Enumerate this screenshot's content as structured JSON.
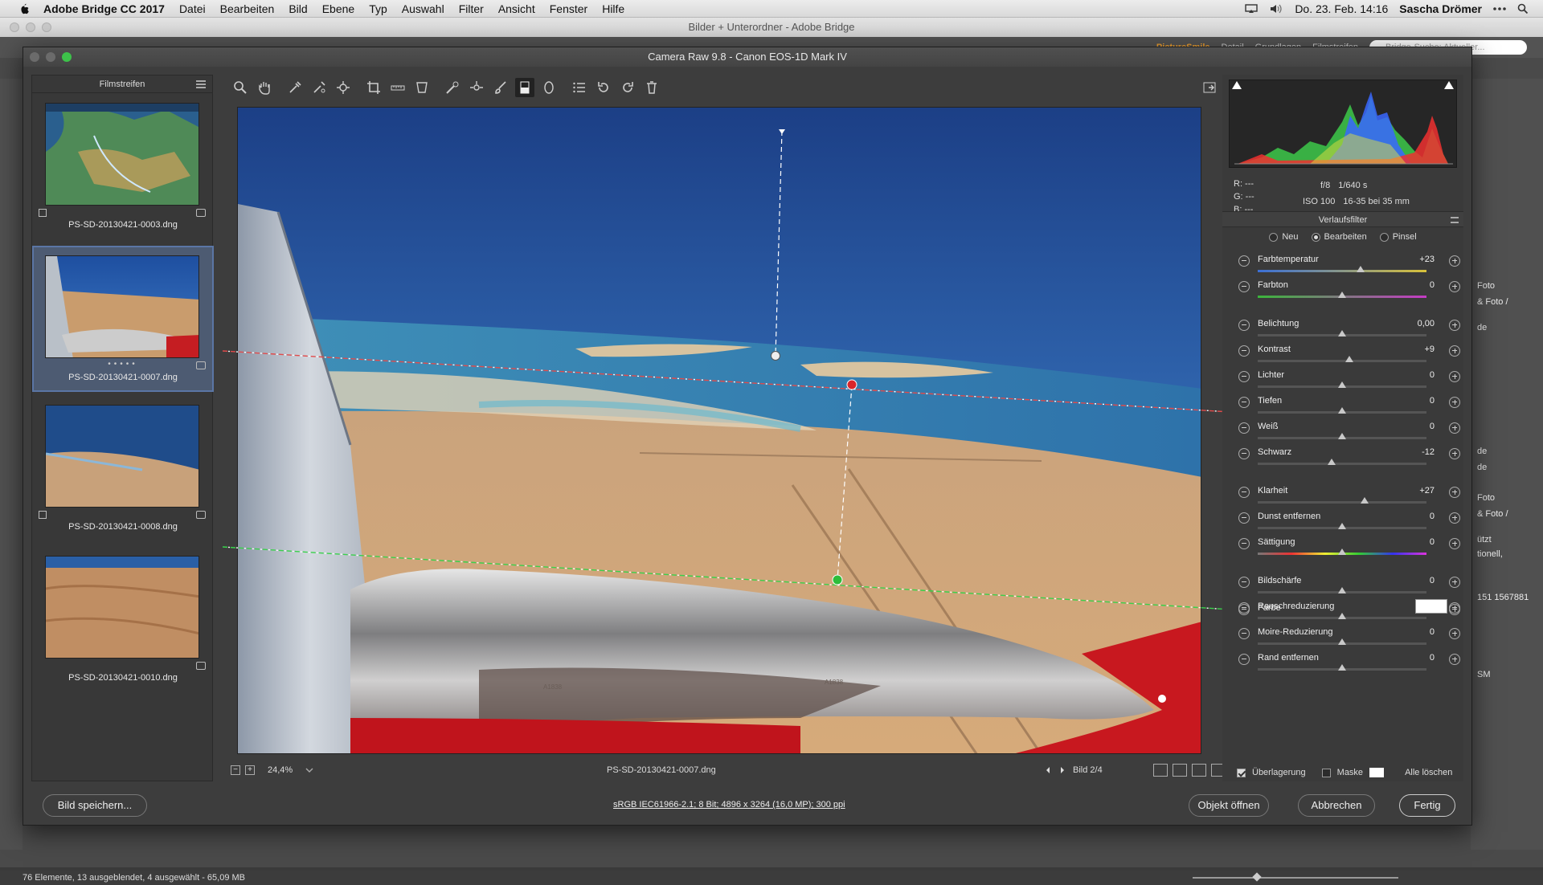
{
  "menubar": {
    "app_name": "Adobe Bridge CC 2017",
    "items": [
      "Datei",
      "Bearbeiten",
      "Bild",
      "Ebene",
      "Typ",
      "Auswahl",
      "Filter",
      "Ansicht",
      "Fenster",
      "Hilfe"
    ],
    "datetime": "Do. 23. Feb. 14:16",
    "user": "Sascha Drömer"
  },
  "bridge": {
    "title": "Bilder + Unterordner - Adobe Bridge",
    "workspaces": [
      "PictureSmile",
      "Detail",
      "Grundlagen",
      "Filmstreifen"
    ],
    "search_placeholder": "Bridge-Suche: Aktueller...",
    "status": "76 Elemente, 13 ausgeblendet, 4 ausgewählt - 65,09 MB",
    "side_texts": [
      "Foto",
      "& Foto /",
      "de",
      "de",
      "de",
      "Foto",
      "& Foto /",
      "ützt",
      "tionell,",
      "151 1567881",
      "SM"
    ]
  },
  "acr": {
    "title": "Camera Raw 9.8  -  Canon EOS-1D Mark IV",
    "filmstrip": {
      "title": "Filmstreifen",
      "items": [
        {
          "name": "PS-SD-20130421-0003.dng",
          "selected": false
        },
        {
          "name": "PS-SD-20130421-0007.dng",
          "selected": true
        },
        {
          "name": "PS-SD-20130421-0008.dng",
          "selected": false
        },
        {
          "name": "PS-SD-20130421-0010.dng",
          "selected": false
        }
      ]
    },
    "preview_bar": {
      "zoom": "24,4%",
      "filename": "PS-SD-20130421-0007.dng",
      "image_index": "Bild 2/4"
    },
    "histogram_info": {
      "r": "R:   ---",
      "g": "G:   ---",
      "b": "B:   ---",
      "aperture": "f/8",
      "shutter": "1/640 s",
      "iso": "ISO 100",
      "lens": "16-35 bei 35 mm"
    },
    "panel": {
      "title": "Verlaufsfilter",
      "modes": [
        "Neu",
        "Bearbeiten",
        "Pinsel"
      ],
      "selected_mode": "Bearbeiten",
      "sliders": [
        {
          "label": "Farbtemperatur",
          "value": "+23",
          "pos": 0.61,
          "track": "temp"
        },
        {
          "label": "Farbton",
          "value": "0",
          "pos": 0.5,
          "track": "tint"
        },
        {
          "label": "Belichtung",
          "value": "0,00",
          "pos": 0.5,
          "track": ""
        },
        {
          "label": "Kontrast",
          "value": "+9",
          "pos": 0.545,
          "track": ""
        },
        {
          "label": "Lichter",
          "value": "0",
          "pos": 0.5,
          "track": ""
        },
        {
          "label": "Tiefen",
          "value": "0",
          "pos": 0.5,
          "track": ""
        },
        {
          "label": "Weiß",
          "value": "0",
          "pos": 0.5,
          "track": ""
        },
        {
          "label": "Schwarz",
          "value": "-12",
          "pos": 0.44,
          "track": ""
        },
        {
          "label": "Klarheit",
          "value": "+27",
          "pos": 0.635,
          "track": ""
        },
        {
          "label": "Dunst entfernen",
          "value": "0",
          "pos": 0.5,
          "track": ""
        },
        {
          "label": "Sättigung",
          "value": "0",
          "pos": 0.5,
          "track": "sat"
        },
        {
          "label": "Bildschärfe",
          "value": "0",
          "pos": 0.5,
          "track": ""
        },
        {
          "label": "Rauschreduzierung",
          "value": "0",
          "pos": 0.5,
          "track": ""
        },
        {
          "label": "Moire-Reduzierung",
          "value": "0",
          "pos": 0.5,
          "track": ""
        },
        {
          "label": "Rand entfernen",
          "value": "0",
          "pos": 0.5,
          "track": ""
        }
      ],
      "color_label": "Farbe",
      "overlay_label": "Überlagerung",
      "mask_label": "Maske",
      "clear_all": "Alle löschen"
    },
    "footer": {
      "save": "Bild speichern...",
      "info": "sRGB IEC61966-2.1; 8 Bit; 4896 x 3264 (16,0 MP); 300 ppi",
      "open": "Objekt öffnen",
      "cancel": "Abbrechen",
      "done": "Fertig"
    }
  },
  "colors": {
    "accent_red_pin": "#d9262b",
    "accent_green_pin": "#2dbd3a",
    "workspace_active": "#f0a030",
    "selection": "#5b76a5"
  }
}
